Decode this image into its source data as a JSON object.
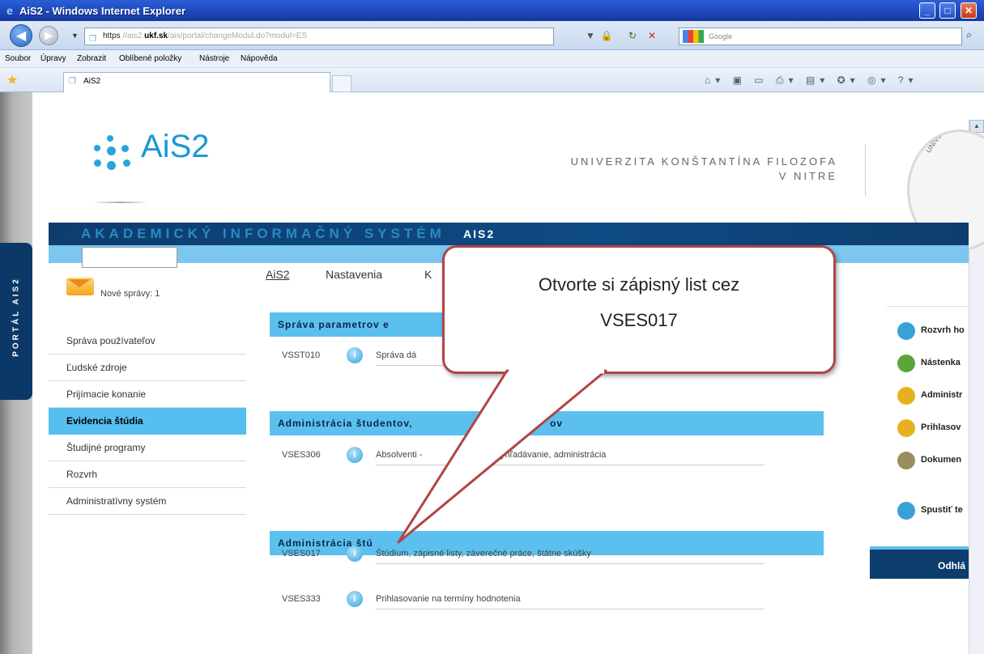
{
  "window": {
    "title": "AiS2 - Windows Internet Explorer"
  },
  "browser": {
    "address_prefix": "https",
    "address_host_bold": "ukf.sk",
    "address_rest": "//ais2.ukf.sk/ais/portal/changeModul.do?modul=ES",
    "search_placeholder": "Google",
    "menu": [
      "Soubor",
      "Úpravy",
      "Zobrazit",
      "Oblíbené položky",
      "Nástroje",
      "Nápověda"
    ],
    "tab_label": "AiS2"
  },
  "portal": {
    "side_tab": "PORTÁL AIS2",
    "logo_text": "AiS",
    "logo_sub": "2",
    "university_line1": "UNIVERZITA KONŠTANTÍNA FILOZOFA",
    "university_line2": "V NITRE",
    "seal_text": "UNIVERZITA KONŠ",
    "banner_text": "AKADEMICKÝ INFORMAČNÝ SYSTÉM",
    "banner_bold": "AIS2",
    "new_messages": "Nové správy: 1"
  },
  "sidenav": {
    "items": [
      "Správa používateľov",
      "Ľudské zdroje",
      "Prijímacie konanie",
      "Evidencia štúdia",
      "Študijné programy",
      "Rozvrh",
      "Administratívny systém"
    ],
    "selected": "Evidencia štúdia"
  },
  "top_tabs": [
    "AiS2",
    "Nastavenia",
    "K"
  ],
  "sections": [
    {
      "title": "Správa parametrov e",
      "rows": [
        {
          "code": "VSST010",
          "desc": "Správa dá"
        }
      ]
    },
    {
      "title": "Administrácia študentov,",
      "title_tail": "ov",
      "rows": [
        {
          "code": "VSES306",
          "desc": "Absolventi -",
          "desc_tail": "yhľadávanie, administrácia"
        }
      ]
    },
    {
      "title": "Administrácia štú",
      "rows": [
        {
          "code": "VSES017",
          "desc": "Štúdium, zápisné listy, záverečné práce, štátne skúšky"
        },
        {
          "code": "VSES333",
          "desc": "Prihlasovanie na termíny hodnotenia"
        }
      ]
    }
  ],
  "right_panel": {
    "items": [
      {
        "label": "Rozvrh ho",
        "color": "#3aa0d8"
      },
      {
        "label": "Nástenka",
        "color": "#5aa63c"
      },
      {
        "label": "Administr",
        "color": "#e6b020"
      },
      {
        "label": "Prihlasov",
        "color": "#e6b020"
      },
      {
        "label": "Dokumen",
        "color": "#9a8e5e"
      },
      {
        "label": "Spustiť te",
        "color": "#3aa0d8"
      }
    ],
    "logout": "Odhlá"
  },
  "callout": {
    "line1": "Otvorte si zápisný list cez",
    "line2": "VSES017"
  },
  "colors": {
    "accent": "#5cc0ef",
    "navy": "#0d3d6d",
    "callout_border": "#b04545"
  }
}
